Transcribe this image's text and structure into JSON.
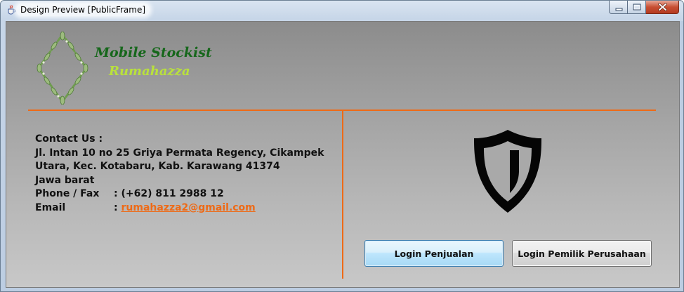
{
  "window": {
    "title": "Design Preview [PublicFrame]",
    "app_icon": "java-cup-icon",
    "controls": [
      "minimize-icon",
      "maximize-icon",
      "close-icon"
    ]
  },
  "brand": {
    "line1": "Mobile Stockist",
    "line2": "Rumahazza",
    "logo": "leaf-wreath-diamond-logo",
    "color_line1": "#16671b",
    "color_line2": "#b9e13c"
  },
  "contact": {
    "heading": "Contact Us :",
    "address_line1": "Jl. Intan 10 no 25 Griya Permata Regency, Cikampek",
    "address_line2": "Utara, Kec. Kotabaru, Kab. Karawang 41374",
    "address_line3": "Jawa barat",
    "phone_label": "Phone / Fax",
    "phone_value": ": (+62) 811 2988 12",
    "email_label": "Email",
    "email_prefix": ":",
    "email_value": "rumahazza2@gmail.com"
  },
  "login": {
    "icon": "shield-icon",
    "buttons": [
      {
        "label": "Login Penjualan"
      },
      {
        "label": "Login Pemilik Perusahaan"
      }
    ]
  },
  "colors": {
    "accent": "#ee6a16",
    "panel_top": "#8c8c8c",
    "panel_bottom": "#c8c8c8"
  }
}
